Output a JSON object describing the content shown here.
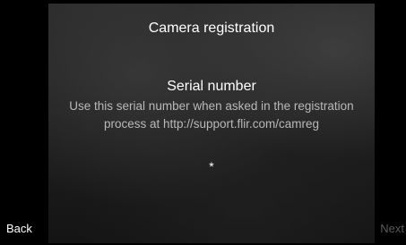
{
  "screen": {
    "title": "Camera registration"
  },
  "content": {
    "heading": "Serial number",
    "instructions": "Use this serial number when asked in the registration process at http://support.flir.com/camreg",
    "serial_value": "*"
  },
  "navigation": {
    "back_label": "Back",
    "next_label": "Next",
    "next_enabled": false
  },
  "colors": {
    "background": "#000000",
    "primary_text": "#ffffff",
    "secondary_text": "#b9b9b9",
    "disabled_text": "#5a5a5a"
  }
}
